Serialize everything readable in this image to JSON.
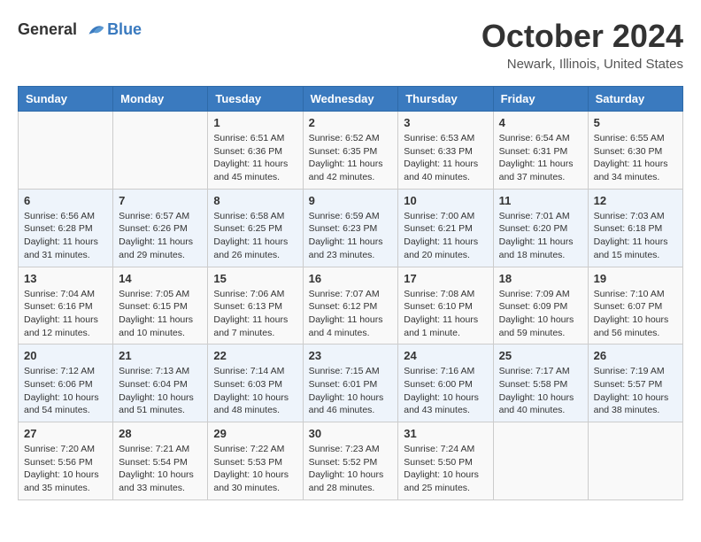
{
  "header": {
    "logo_line1": "General",
    "logo_line2": "Blue",
    "month": "October 2024",
    "location": "Newark, Illinois, United States"
  },
  "days_of_week": [
    "Sunday",
    "Monday",
    "Tuesday",
    "Wednesday",
    "Thursday",
    "Friday",
    "Saturday"
  ],
  "weeks": [
    [
      {
        "day": "",
        "content": ""
      },
      {
        "day": "",
        "content": ""
      },
      {
        "day": "1",
        "content": "Sunrise: 6:51 AM\nSunset: 6:36 PM\nDaylight: 11 hours and 45 minutes."
      },
      {
        "day": "2",
        "content": "Sunrise: 6:52 AM\nSunset: 6:35 PM\nDaylight: 11 hours and 42 minutes."
      },
      {
        "day": "3",
        "content": "Sunrise: 6:53 AM\nSunset: 6:33 PM\nDaylight: 11 hours and 40 minutes."
      },
      {
        "day": "4",
        "content": "Sunrise: 6:54 AM\nSunset: 6:31 PM\nDaylight: 11 hours and 37 minutes."
      },
      {
        "day": "5",
        "content": "Sunrise: 6:55 AM\nSunset: 6:30 PM\nDaylight: 11 hours and 34 minutes."
      }
    ],
    [
      {
        "day": "6",
        "content": "Sunrise: 6:56 AM\nSunset: 6:28 PM\nDaylight: 11 hours and 31 minutes."
      },
      {
        "day": "7",
        "content": "Sunrise: 6:57 AM\nSunset: 6:26 PM\nDaylight: 11 hours and 29 minutes."
      },
      {
        "day": "8",
        "content": "Sunrise: 6:58 AM\nSunset: 6:25 PM\nDaylight: 11 hours and 26 minutes."
      },
      {
        "day": "9",
        "content": "Sunrise: 6:59 AM\nSunset: 6:23 PM\nDaylight: 11 hours and 23 minutes."
      },
      {
        "day": "10",
        "content": "Sunrise: 7:00 AM\nSunset: 6:21 PM\nDaylight: 11 hours and 20 minutes."
      },
      {
        "day": "11",
        "content": "Sunrise: 7:01 AM\nSunset: 6:20 PM\nDaylight: 11 hours and 18 minutes."
      },
      {
        "day": "12",
        "content": "Sunrise: 7:03 AM\nSunset: 6:18 PM\nDaylight: 11 hours and 15 minutes."
      }
    ],
    [
      {
        "day": "13",
        "content": "Sunrise: 7:04 AM\nSunset: 6:16 PM\nDaylight: 11 hours and 12 minutes."
      },
      {
        "day": "14",
        "content": "Sunrise: 7:05 AM\nSunset: 6:15 PM\nDaylight: 11 hours and 10 minutes."
      },
      {
        "day": "15",
        "content": "Sunrise: 7:06 AM\nSunset: 6:13 PM\nDaylight: 11 hours and 7 minutes."
      },
      {
        "day": "16",
        "content": "Sunrise: 7:07 AM\nSunset: 6:12 PM\nDaylight: 11 hours and 4 minutes."
      },
      {
        "day": "17",
        "content": "Sunrise: 7:08 AM\nSunset: 6:10 PM\nDaylight: 11 hours and 1 minute."
      },
      {
        "day": "18",
        "content": "Sunrise: 7:09 AM\nSunset: 6:09 PM\nDaylight: 10 hours and 59 minutes."
      },
      {
        "day": "19",
        "content": "Sunrise: 7:10 AM\nSunset: 6:07 PM\nDaylight: 10 hours and 56 minutes."
      }
    ],
    [
      {
        "day": "20",
        "content": "Sunrise: 7:12 AM\nSunset: 6:06 PM\nDaylight: 10 hours and 54 minutes."
      },
      {
        "day": "21",
        "content": "Sunrise: 7:13 AM\nSunset: 6:04 PM\nDaylight: 10 hours and 51 minutes."
      },
      {
        "day": "22",
        "content": "Sunrise: 7:14 AM\nSunset: 6:03 PM\nDaylight: 10 hours and 48 minutes."
      },
      {
        "day": "23",
        "content": "Sunrise: 7:15 AM\nSunset: 6:01 PM\nDaylight: 10 hours and 46 minutes."
      },
      {
        "day": "24",
        "content": "Sunrise: 7:16 AM\nSunset: 6:00 PM\nDaylight: 10 hours and 43 minutes."
      },
      {
        "day": "25",
        "content": "Sunrise: 7:17 AM\nSunset: 5:58 PM\nDaylight: 10 hours and 40 minutes."
      },
      {
        "day": "26",
        "content": "Sunrise: 7:19 AM\nSunset: 5:57 PM\nDaylight: 10 hours and 38 minutes."
      }
    ],
    [
      {
        "day": "27",
        "content": "Sunrise: 7:20 AM\nSunset: 5:56 PM\nDaylight: 10 hours and 35 minutes."
      },
      {
        "day": "28",
        "content": "Sunrise: 7:21 AM\nSunset: 5:54 PM\nDaylight: 10 hours and 33 minutes."
      },
      {
        "day": "29",
        "content": "Sunrise: 7:22 AM\nSunset: 5:53 PM\nDaylight: 10 hours and 30 minutes."
      },
      {
        "day": "30",
        "content": "Sunrise: 7:23 AM\nSunset: 5:52 PM\nDaylight: 10 hours and 28 minutes."
      },
      {
        "day": "31",
        "content": "Sunrise: 7:24 AM\nSunset: 5:50 PM\nDaylight: 10 hours and 25 minutes."
      },
      {
        "day": "",
        "content": ""
      },
      {
        "day": "",
        "content": ""
      }
    ]
  ]
}
